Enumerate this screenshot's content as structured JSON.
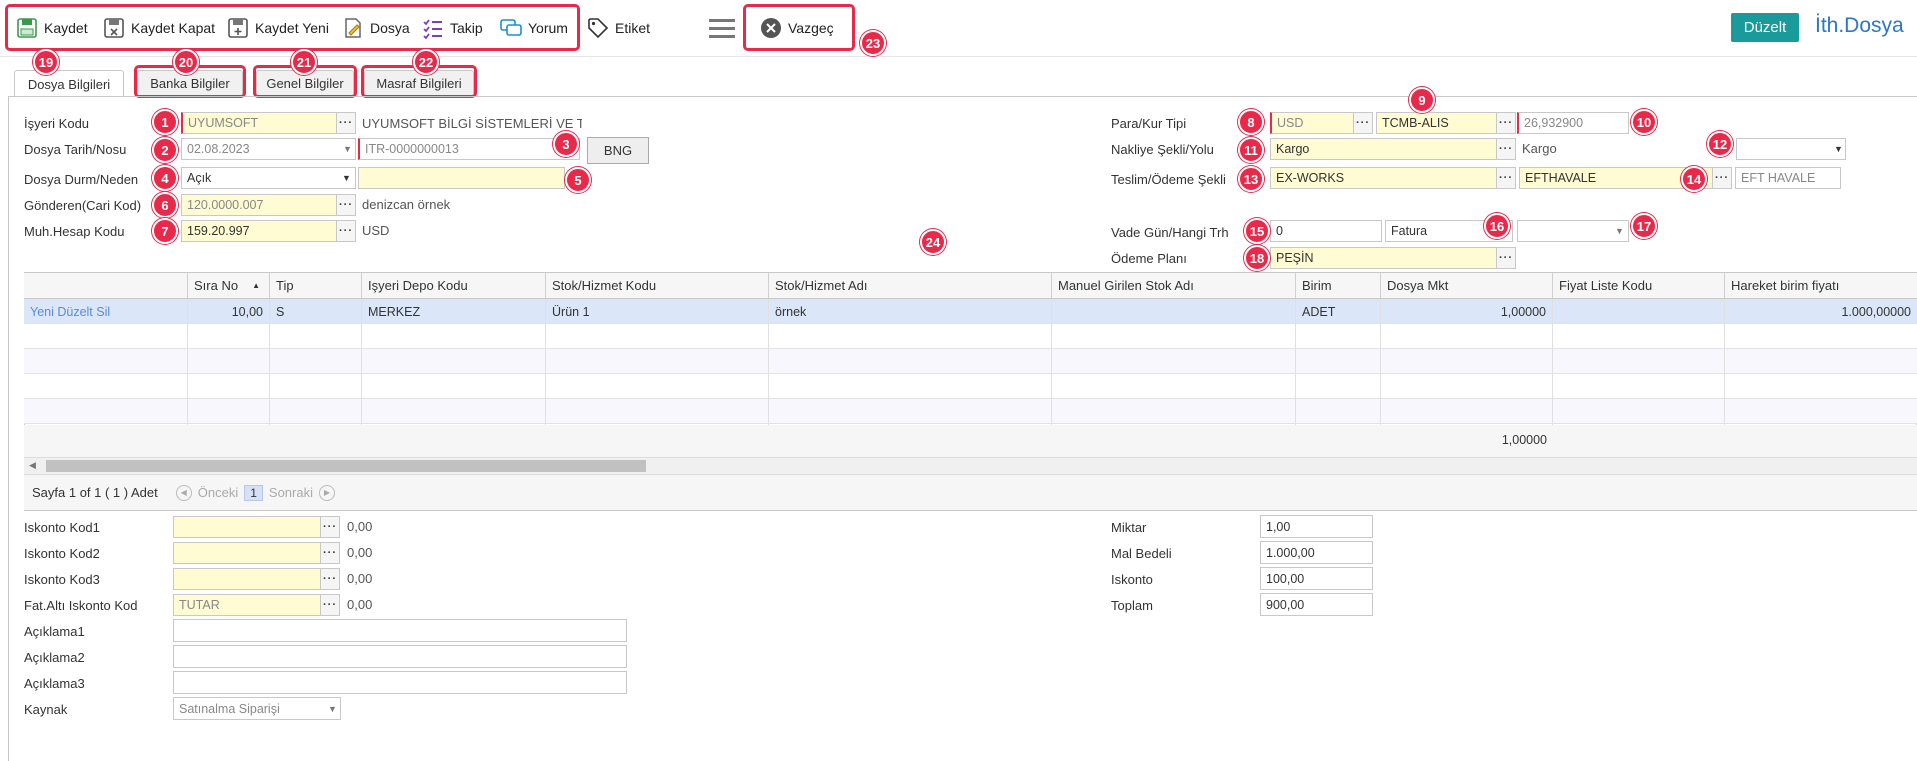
{
  "toolbar": {
    "kaydet": "Kaydet",
    "kaydet_kapat": "Kaydet Kapat",
    "kaydet_yeni": "Kaydet Yeni",
    "dosya": "Dosya",
    "takip": "Takip",
    "yorum": "Yorum",
    "etiket": "Etiket",
    "vazgec": "Vazgeç",
    "duzelt": "Düzelt",
    "ith_dosya": "İth.Dosya"
  },
  "tabs": [
    "Dosya Bilgileri",
    "Banka Bilgiler",
    "Genel Bilgiler",
    "Masraf Bilgileri"
  ],
  "badges": [
    "1",
    "2",
    "3",
    "4",
    "5",
    "6",
    "7",
    "8",
    "9",
    "10",
    "11",
    "12",
    "13",
    "14",
    "15",
    "16",
    "17",
    "18",
    "19",
    "20",
    "21",
    "22",
    "23",
    "24"
  ],
  "form_left": {
    "isyeri_kodu_label": "İşyeri Kodu",
    "isyeri_kodu": "UYUMSOFT",
    "isyeri_adi": "UYUMSOFT BİLGİ SİSTEMLERİ VE T",
    "dosya_tarih_label": "Dosya Tarih/Nosu",
    "dosya_tarih": "02.08.2023",
    "dosya_no": "ITR-0000000013",
    "bng": "BNG",
    "durum_label": "Dosya Durm/Neden",
    "durum": "Açık",
    "gonderen_label": "Gönderen(Cari Kod)",
    "gonderen": "120.0000.007",
    "gonderen_adi": "denizcan örnek",
    "muh_label": "Muh.Hesap Kodu",
    "muh": "159.20.997",
    "muh_currency": "USD"
  },
  "form_right": {
    "para_label": "Para/Kur Tipi",
    "para": "USD",
    "kur_tipi": "TCMB-ALIS",
    "kur": "26,932900",
    "nakliye_label": "Nakliye Şekli/Yolu",
    "nakliye": "Kargo",
    "nakliye_adi": "Kargo",
    "teslim_label": "Teslim/Ödeme Şekli",
    "teslim": "EX-WORKS",
    "odeme": "EFTHAVALE",
    "odeme_adi": "EFT HAVALE",
    "vade_label": "Vade Gün/Hangi Trh",
    "vade": "0",
    "hangi_trh": "Fatura",
    "odeme_plan_label": "Ödeme Planı",
    "odeme_plan": "PEŞİN"
  },
  "grid": {
    "headers": [
      "",
      "Sıra No",
      "Tip",
      "Işyeri Depo Kodu",
      "Stok/Hizmet Kodu",
      "Stok/Hizmet Adı",
      "Manuel Girilen Stok Adı",
      "Birim",
      "Dosya Mkt",
      "Fiyat Liste Kodu",
      "Hareket birim fiyatı"
    ],
    "sort_icon": "▲",
    "row": [
      "Yeni Düzelt Sil",
      "10,00",
      "S",
      "MERKEZ",
      "Ürün 1",
      "örnek",
      "",
      "ADET",
      "1,00000",
      "",
      "1.000,00000"
    ],
    "total": "1,00000"
  },
  "pager": {
    "info": "Sayfa 1 of 1 ( 1 ) Adet",
    "prev": "Önceki",
    "page": "1",
    "next": "Sonraki"
  },
  "bottom_left": {
    "isk1_label": "Iskonto Kod1",
    "isk1_val": "0,00",
    "isk2_label": "Iskonto Kod2",
    "isk2_val": "0,00",
    "isk3_label": "Iskonto Kod3",
    "isk3_val": "0,00",
    "fat_label": "Fat.Altı Iskonto Kod",
    "fat_code": "TUTAR",
    "fat_val": "0,00",
    "acik1_label": "Açıklama1",
    "acik2_label": "Açıklama2",
    "acik3_label": "Açıklama3",
    "kaynak_label": "Kaynak",
    "kaynak": "Satınalma Siparişi"
  },
  "bottom_right": {
    "miktar_label": "Miktar",
    "miktar": "1,00",
    "mal_label": "Mal Bedeli",
    "mal": "1.000,00",
    "isk_label": "Iskonto",
    "isk": "100,00",
    "toplam_label": "Toplam",
    "toplam": "900,00"
  },
  "colors": {
    "accent_red": "#e8294a",
    "teal": "#1a9a9a",
    "link_blue": "#2a77c9",
    "field_yellow": "#fffbd2",
    "row_selected": "#dbe6f8"
  }
}
